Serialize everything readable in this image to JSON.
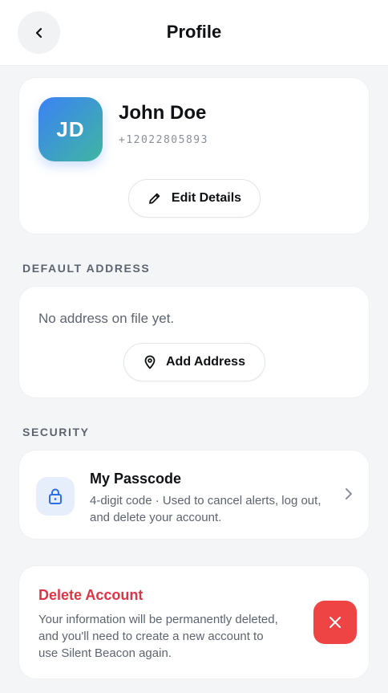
{
  "header": {
    "title": "Profile",
    "back_icon": "chevron-left-icon"
  },
  "profile": {
    "initials": "JD",
    "name": "John Doe",
    "phone": "+12022805893",
    "edit_label": "Edit Details",
    "edit_icon": "pencil-icon",
    "avatar_gradient": [
      "#3b82f6",
      "#3fb6a0"
    ]
  },
  "address": {
    "section_label": "DEFAULT ADDRESS",
    "empty_text": "No address on file yet.",
    "add_label": "Add Address",
    "add_icon": "map-pin-icon"
  },
  "security": {
    "section_label": "SECURITY",
    "passcode_title": "My Passcode",
    "passcode_desc": "4-digit code · Used to cancel alerts, log out, and delete your account.",
    "lock_icon": "lock-icon",
    "chevron_icon": "chevron-right-icon"
  },
  "delete": {
    "title": "Delete Account",
    "desc": "Your information will be permanently deleted, and you'll need to create a new account to use Silent Beacon again.",
    "icon": "close-icon",
    "color": "#ef4444",
    "title_color": "#dc3545"
  }
}
